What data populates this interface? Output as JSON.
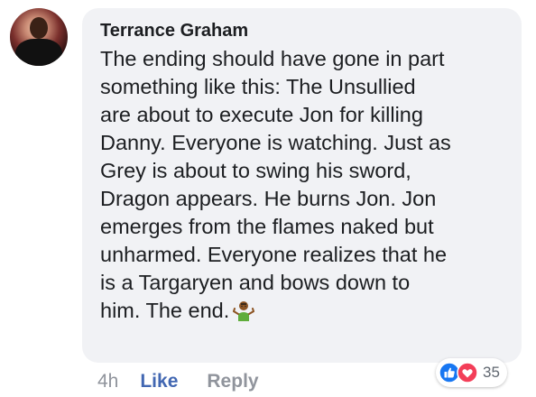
{
  "comment": {
    "author": "Terrance Graham",
    "text": "The ending should have gone in part\nsomething like this: The Unsullied\nare about to execute Jon for killing\nDanny. Everyone is watching. Just as\nGrey is about to swing his sword,\nDragon appears. He burns Jon. Jon\nemerges from the flames naked but\nunharmed. Everyone realizes that he\nis a Targaryen and bows down to\nhim. The end.",
    "emoji": "person-shrugging-icon",
    "time": "4h",
    "like_label": "Like",
    "reply_label": "Reply",
    "reaction_count": "35",
    "reactions": [
      "like-icon",
      "love-icon"
    ]
  },
  "colors": {
    "bubble": "#f1f2f5",
    "link": "#4267b2",
    "muted": "#90949c",
    "text": "#1c1e21",
    "like_reaction": "#1877f2",
    "love_reaction": "#f33e58"
  }
}
